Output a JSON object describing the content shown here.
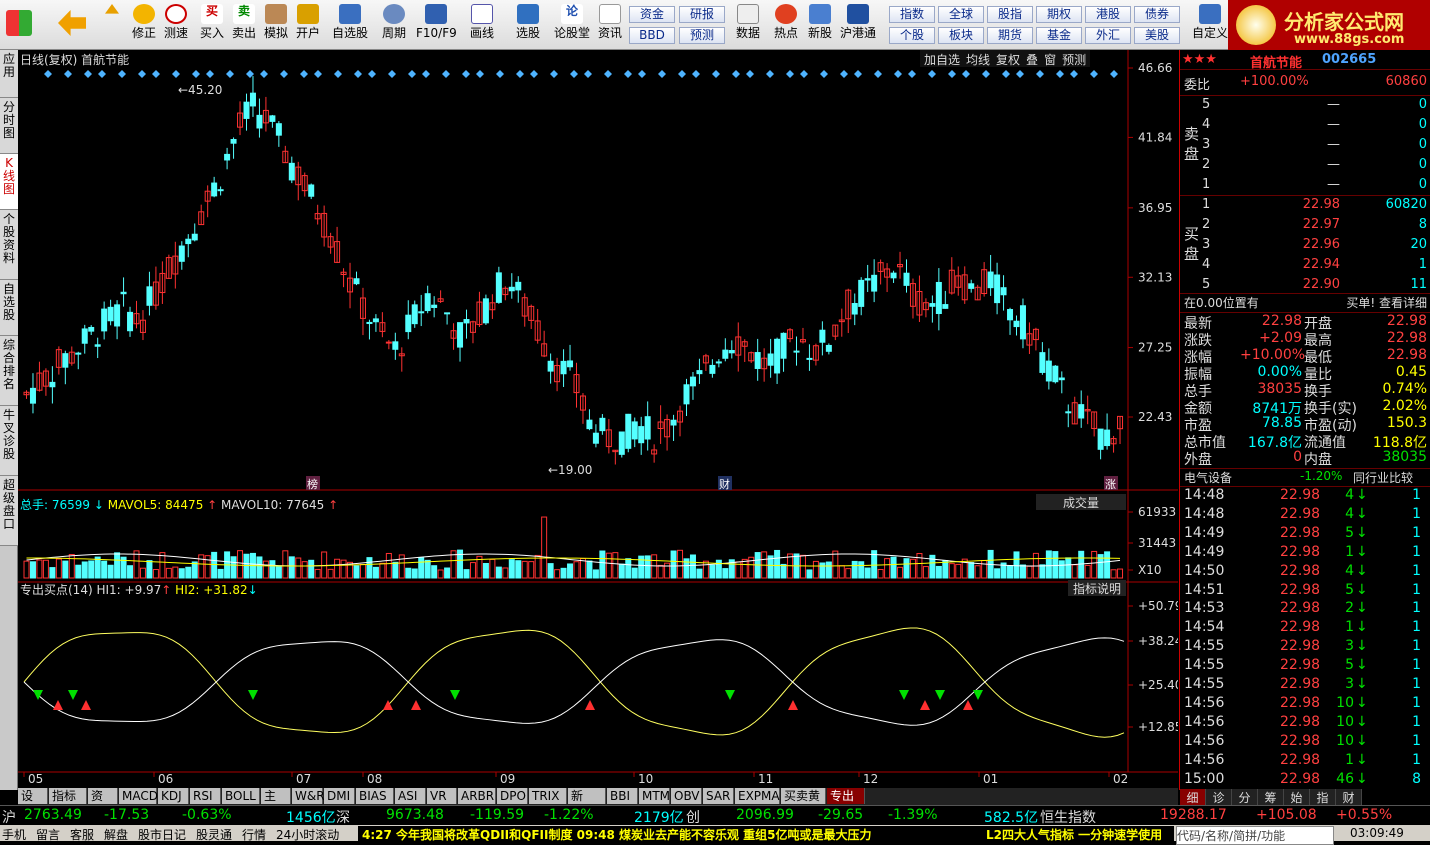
{
  "toolbar": {
    "items": [
      "修正",
      "测速",
      "买入",
      "卖出",
      "模拟",
      "开户",
      "自选股",
      "周期",
      "F10/F9",
      "画线",
      "选股",
      "论股堂",
      "资讯",
      "数据",
      "热点",
      "新股",
      "沪港通",
      "自定义"
    ],
    "small": [
      "资金",
      "研报",
      "BBD",
      "预测",
      "指数",
      "全球",
      "股指",
      "期权",
      "港股",
      "债券",
      "个股",
      "板块",
      "期货",
      "基金",
      "外汇",
      "美股"
    ]
  },
  "logo": {
    "text": "分析家公式网",
    "url": "www.88gs.com"
  },
  "leftnav": [
    "应用",
    "分时图",
    "K线图",
    "个股资料",
    "自选股",
    "综合排名",
    "牛叉诊股",
    "超级盘口"
  ],
  "chart": {
    "title": "日线(复权)  首航节能",
    "tools": [
      "加自选",
      "均线",
      "复权",
      "叠",
      "窗",
      "预测"
    ],
    "yaxis": [
      "46.66",
      "41.84",
      "36.95",
      "32.13",
      "27.25",
      "22.43"
    ],
    "high_label": "45.20",
    "low_label": "19.00",
    "markers": [
      "榜",
      "财",
      "涨"
    ],
    "vol_header": {
      "total": "总手: 76599",
      "mavol5": "MAVOL5: 84475",
      "mavol10": "MAVOL10: 77645",
      "button": "成交量"
    },
    "vol_axis": [
      "61933",
      "31443",
      "X10"
    ],
    "ind_header": {
      "name": "专出买点(14)",
      "hi1": "HI1: +9.97",
      "hi2": "HI2: +31.82",
      "button": "指标说明"
    },
    "ind_axis": [
      "+50.79",
      "+38.24",
      "+25.40",
      "+12.85"
    ],
    "xaxis": [
      "05",
      "06",
      "07",
      "08",
      "09",
      "10",
      "11",
      "12",
      "01",
      "02"
    ],
    "closes": [
      24,
      25,
      26,
      27,
      28,
      29,
      30,
      29,
      31,
      33,
      35,
      37,
      39,
      42,
      44,
      43,
      41,
      39,
      37,
      35,
      32,
      30,
      28,
      27,
      29,
      31,
      30,
      28,
      29,
      31,
      32,
      30,
      28,
      26,
      25,
      22,
      21,
      21,
      22,
      21,
      22,
      24,
      25,
      27,
      28,
      27,
      26,
      27,
      28,
      27,
      28,
      30,
      31,
      32,
      33,
      31,
      30,
      31,
      32,
      31,
      32,
      30,
      29,
      27,
      25,
      23,
      22,
      21,
      22
    ]
  },
  "rp": {
    "title": "首航节能",
    "code": "002665",
    "weibi_label": "委比",
    "weibi": "+100.00%",
    "weicha": "60860",
    "sell": [
      [
        "5",
        "—",
        "0"
      ],
      [
        "4",
        "—",
        "0"
      ],
      [
        "3",
        "—",
        "0"
      ],
      [
        "2",
        "—",
        "0"
      ],
      [
        "1",
        "—",
        "0"
      ]
    ],
    "buy": [
      [
        "1",
        "22.98",
        "60820"
      ],
      [
        "2",
        "22.97",
        "8"
      ],
      [
        "3",
        "22.96",
        "20"
      ],
      [
        "4",
        "22.94",
        "1"
      ],
      [
        "5",
        "22.90",
        "11"
      ]
    ],
    "sell_label": "卖盘",
    "buy_label": "买盘",
    "pos": "在0.00位置有",
    "buylink": "买单! 查看详细",
    "stats": [
      [
        "最新",
        "22.98",
        "开盘",
        "22.98"
      ],
      [
        "涨跌",
        "+2.09",
        "最高",
        "22.98"
      ],
      [
        "涨幅",
        "+10.00%",
        "最低",
        "22.98"
      ],
      [
        "振幅",
        "0.00%",
        "量比",
        "0.45"
      ],
      [
        "总手",
        "38035",
        "换手",
        "0.74%"
      ],
      [
        "金额",
        "8741万",
        "换手(实)",
        "2.02%"
      ],
      [
        "市盈",
        "78.85",
        "市盈(动)",
        "150.3"
      ],
      [
        "总市值",
        "167.8亿",
        "流通值",
        "118.8亿"
      ],
      [
        "外盘",
        "0",
        "内盘",
        "38035"
      ]
    ],
    "industry": "电气设备",
    "industry_chg": "-1.20%",
    "compare": "同行业比较",
    "ticks": [
      [
        "14:48",
        "22.98",
        "4"
      ],
      [
        "14:48",
        "22.98",
        "4"
      ],
      [
        "14:49",
        "22.98",
        "5"
      ],
      [
        "14:49",
        "22.98",
        "1"
      ],
      [
        "14:50",
        "22.98",
        "4"
      ],
      [
        "14:51",
        "22.98",
        "5"
      ],
      [
        "14:53",
        "22.98",
        "2"
      ],
      [
        "14:54",
        "22.98",
        "1"
      ],
      [
        "14:55",
        "22.98",
        "3"
      ],
      [
        "14:55",
        "22.98",
        "5"
      ],
      [
        "14:55",
        "22.98",
        "3"
      ],
      [
        "14:56",
        "22.98",
        "10"
      ],
      [
        "14:56",
        "22.98",
        "10"
      ],
      [
        "14:56",
        "22.98",
        "10"
      ],
      [
        "14:56",
        "22.98",
        "1"
      ],
      [
        "15:00",
        "22.98",
        "46"
      ]
    ],
    "ticks_last": [
      "1",
      "1",
      "1",
      "1",
      "1",
      "1",
      "1",
      "1",
      "1",
      "1",
      "1",
      "1",
      "1",
      "1",
      "1",
      "8"
    ],
    "bottom_tabs": [
      "细",
      "诊",
      "分",
      "筹",
      "始",
      "指",
      "财"
    ]
  },
  "tabs": [
    "设置",
    "指标平台",
    "资讯",
    "MACD",
    "KDJ",
    "RSI",
    "BOLL",
    "主力",
    "W&R",
    "DMI",
    "BIAS",
    "ASI",
    "VR",
    "ARBR",
    "DPO",
    "TRIX",
    "新DMA",
    "BBI",
    "MTM",
    "OBV",
    "SAR",
    "EXPMA",
    "买卖黄金线",
    "专出买点"
  ],
  "status": {
    "sh": "沪",
    "sh_val": "2763.49",
    "sh_chg": "-17.53",
    "sh_pct": "-0.63%",
    "sh_amt": "1456亿",
    "sz": "深",
    "sz_val": "9673.48",
    "sz_chg": "-119.59",
    "sz_pct": "-1.22%",
    "sz_amt": "2179亿",
    "cy": "创",
    "cy_val": "2096.99",
    "cy_chg": "-29.65",
    "cy_pct": "-1.39%",
    "cy_amt": "582.5亿",
    "hs": "恒生指数",
    "hs_val": "19288.17",
    "hs_chg": "+105.08",
    "hs_pct": "+0.55%",
    "bar2": [
      "手机",
      "留言",
      "客服",
      "解盘",
      "股市日记",
      "股灵通",
      "行情",
      "24小时滚动"
    ],
    "news1": "4:27 今年我国将改革QDII和QFII制度",
    "news2": "09:48 煤炭业去产能不容乐观 重组5亿吨或是最大压力",
    "news3": "L2四大人气指标 一分钟速学使用",
    "search": "代码/名称/简拼/功能",
    "time": "03:09:49"
  }
}
